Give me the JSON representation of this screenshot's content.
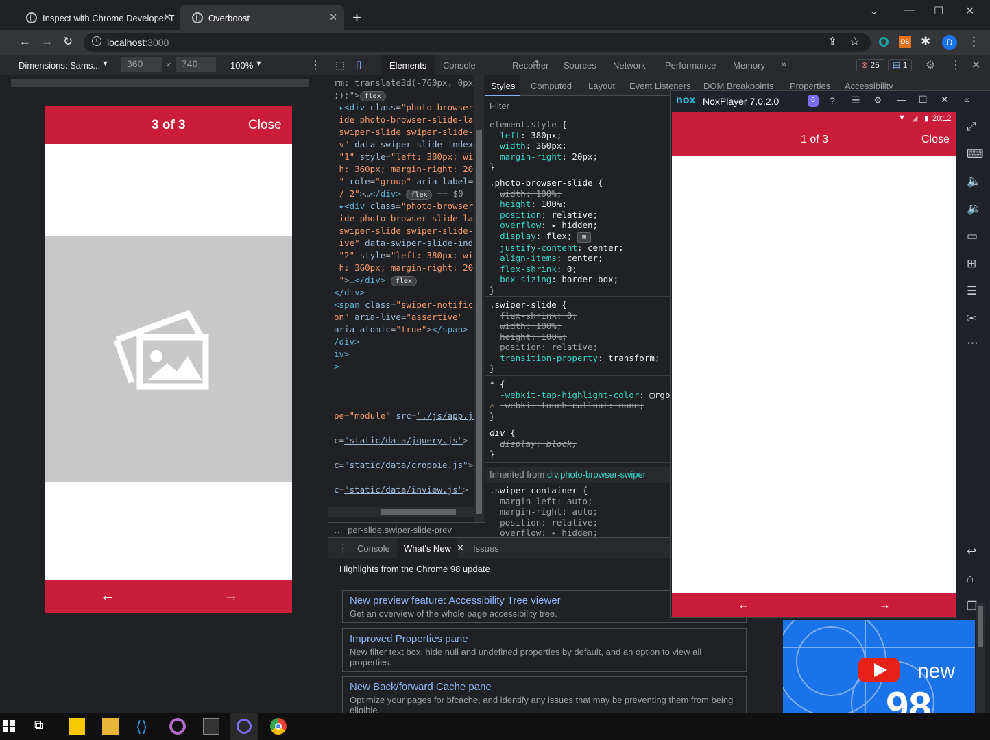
{
  "browser": {
    "tabs": [
      {
        "title": "Inspect with Chrome Developer T"
      },
      {
        "title": "Overboost"
      }
    ],
    "url_host": "localhost",
    "url_path": ":3000",
    "profile_initial": "D"
  },
  "device_toolbar": {
    "dimensions_label": "Dimensions: Sams...",
    "width": "360",
    "height": "740",
    "zoom": "100%"
  },
  "phone": {
    "counter": "3 of 3",
    "close_label": "Close",
    "prev_arrow": "←",
    "next_arrow": "→"
  },
  "devtools": {
    "tabs": [
      "Elements",
      "Console",
      "Recorder",
      "Sources",
      "Network",
      "Performance",
      "Memory"
    ],
    "error_count": "25",
    "message_count": "1",
    "styles_tabs": [
      "Styles",
      "Computed",
      "Layout",
      "Event Listeners",
      "DOM Breakpoints",
      "Properties",
      "Accessibility"
    ],
    "filter_placeholder": "Filter",
    "breadcrumb": "per-slide.swiper-slide-prev",
    "inherited_prefix": "Inherited from",
    "inherited_from": "div.photo-browser-swiper",
    "drawer_tabs": [
      "Console",
      "What's New",
      "Issues"
    ],
    "highlights": "Highlights from the Chrome 98 update",
    "cards": [
      {
        "title": "New preview feature: Accessibility Tree viewer",
        "desc": "Get an overview of the whole page accessibility tree."
      },
      {
        "title": "Improved Properties pane",
        "desc": "New filter text box, hide null and undefined properties by default, and an option to view all properties."
      },
      {
        "title": "New Back/forward Cache pane",
        "desc": "Optimize your pages for bfcache, and identify any issues that may be preventing them from being eligible."
      }
    ],
    "video_text": "new",
    "video_number": "98"
  },
  "nox": {
    "title": "NoxPlayer 7.0.2.0",
    "logo": "nox",
    "time": "20:12",
    "counter": "1 of 3",
    "close_label": "Close",
    "prev_arrow": "←",
    "next_arrow": "→"
  },
  "colors": {
    "brand_red": "#c91d39",
    "devtools_bg": "#202124",
    "link_blue": "#8ab4f8"
  }
}
